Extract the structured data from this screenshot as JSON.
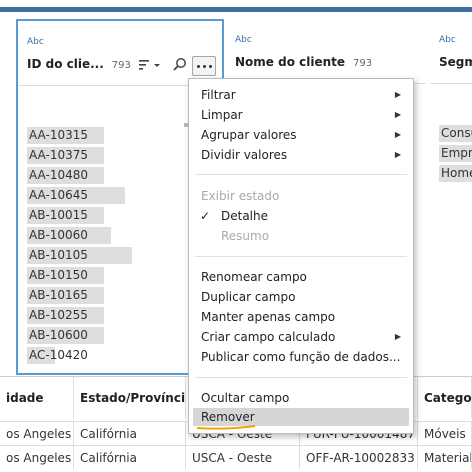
{
  "cards": [
    {
      "type_label": "Abc",
      "title": "ID do clie...",
      "count": "793",
      "values": [
        "AA-10315",
        "AA-10375",
        "AA-10480",
        "AA-10645",
        "AB-10015",
        "AB-10060",
        "AB-10105",
        "AB-10150",
        "AB-10165",
        "AB-10255",
        "AB-10600",
        "AC-10420"
      ],
      "bar_fractions": [
        0.55,
        0.55,
        0.55,
        0.7,
        0.55,
        0.6,
        0.75,
        0.55,
        0.55,
        0.55,
        0.55,
        0.2
      ]
    },
    {
      "type_label": "Abc",
      "title": "Nome do cliente",
      "count": "793"
    },
    {
      "type_label": "Abc",
      "title": "Segme",
      "values": [
        "Consu",
        "Empr",
        "Home"
      ]
    }
  ],
  "context_menu": {
    "items": [
      {
        "label": "Filtrar",
        "submenu": true
      },
      {
        "label": "Limpar",
        "submenu": true
      },
      {
        "label": "Agrupar valores",
        "submenu": true
      },
      {
        "label": "Dividir valores",
        "submenu": true
      },
      {
        "label": "Exibir estado",
        "disabled": true
      },
      {
        "label": "Detalhe",
        "checked": true
      },
      {
        "label": "Resumo",
        "disabled": true
      },
      {
        "label": "Renomear campo"
      },
      {
        "label": "Duplicar campo"
      },
      {
        "label": "Manter apenas campo"
      },
      {
        "label": "Criar campo calculado",
        "submenu": true
      },
      {
        "label": "Publicar como função de dados..."
      },
      {
        "label": "Ocultar campo"
      },
      {
        "label": "Remover",
        "highlighted": true
      }
    ]
  },
  "table": {
    "headers": [
      "idade",
      "Estado/Província",
      "",
      "",
      "Categori"
    ],
    "rows": [
      [
        "os Angeles",
        "Califórnia",
        "USCA - Oeste",
        "FUR-FU-10001487",
        "Móveis"
      ],
      [
        "os Angeles",
        "Califórnia",
        "USCA - Oeste",
        "OFF-AR-10002833",
        "Material"
      ]
    ]
  },
  "colors": {
    "accent": "#3d6e9e",
    "selected_border": "#5b9bd5",
    "type_label": "#3a6fa8",
    "underline": "#f0a500"
  }
}
